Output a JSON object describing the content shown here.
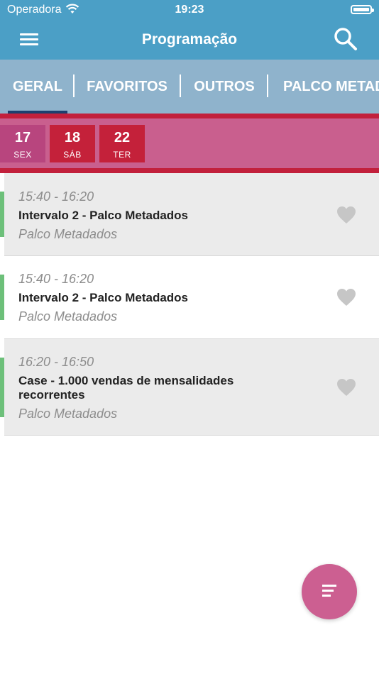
{
  "status_bar": {
    "carrier": "Operadora",
    "time": "19:23"
  },
  "nav": {
    "title": "Programação",
    "menu_icon": "hamburger-menu-icon",
    "search_icon": "search-icon"
  },
  "tabs": [
    {
      "label": "GERAL",
      "selected": true
    },
    {
      "label": "FAVORITOS",
      "selected": false
    },
    {
      "label": "OUTROS",
      "selected": false
    },
    {
      "label": "PALCO METADADOS",
      "selected": false
    }
  ],
  "dates": [
    {
      "day": "17",
      "weekday": "SEX",
      "selected": true
    },
    {
      "day": "18",
      "weekday": "SÁB",
      "selected": false
    },
    {
      "day": "22",
      "weekday": "TER",
      "selected": false
    }
  ],
  "sessions": [
    {
      "time": "15:40 - 16:20",
      "title": "Intervalo 2 - Palco Metadados",
      "venue": "Palco Metadados"
    },
    {
      "time": "15:40 - 16:20",
      "title": "Intervalo 2 - Palco Metadados",
      "venue": "Palco Metadados"
    },
    {
      "time": "16:20 - 16:50",
      "title": "Case - 1.000 vendas de mensalidades recorrentes",
      "venue": "Palco Metadados"
    }
  ],
  "fab_icon": "filter-icon",
  "colors": {
    "header": "#4b9fc6",
    "tabs_bg": "#8fb3cc",
    "date_selected": "#b8457e",
    "date_default": "#c4213a",
    "accent_pink": "#cc5f91",
    "session_bar": "#6dc07a"
  }
}
